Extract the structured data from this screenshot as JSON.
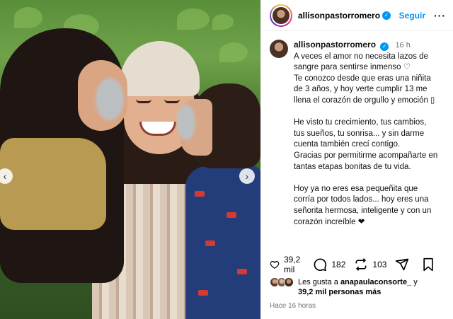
{
  "post": {
    "username": "allisonpastorromero",
    "follow_label": "Seguir",
    "time_short": "16 h",
    "caption": {
      "p1a": "A veces el amor no necesita lazos de",
      "p1b": "sangre para sentirse inmenso ♡",
      "p2a": "Te conozco desde que eras una niñita",
      "p2b": "de 3 años, y hoy verte cumplir 13 me",
      "p2c": "llena el corazón de orgullo y emoción ▯",
      "p3a": "He visto tu crecimiento, tus cambios,",
      "p3b": "tus sueños, tu sonrisa... y sin darme",
      "p3c": "cuenta también crecí contigo.",
      "p3d": "Gracias por permitirme acompañarte en",
      "p3e": "tantas etapas bonitas de tu vida.",
      "p4a": "Hoy ya no eres esa pequeñita que",
      "p4b": "corría por todos lados... hoy eres una",
      "p4c": "señorita hermosa, inteligente y con un",
      "p4d": "corazón increíble ❤"
    },
    "stats": {
      "likes": "39,2 mil",
      "comments": "182",
      "reposts": "103"
    },
    "liked_by": {
      "prefix": "Les gusta a",
      "user": "anapaulaconsorte_",
      "joiner": "y",
      "others": "39,2 mil personas más"
    },
    "time_long": "Hace 16 horas"
  },
  "icons": {
    "heart": "heart-icon",
    "comment": "comment-icon",
    "repost": "repost-icon",
    "share": "share-icon",
    "bookmark": "bookmark-icon",
    "verified": "verified-badge-icon",
    "more": "more-icon",
    "carousel_prev": "chevron-left-icon",
    "carousel_next": "chevron-right-icon"
  },
  "colors": {
    "accent": "#0095f6",
    "muted": "#737373",
    "like_heart": "#e0245e"
  }
}
